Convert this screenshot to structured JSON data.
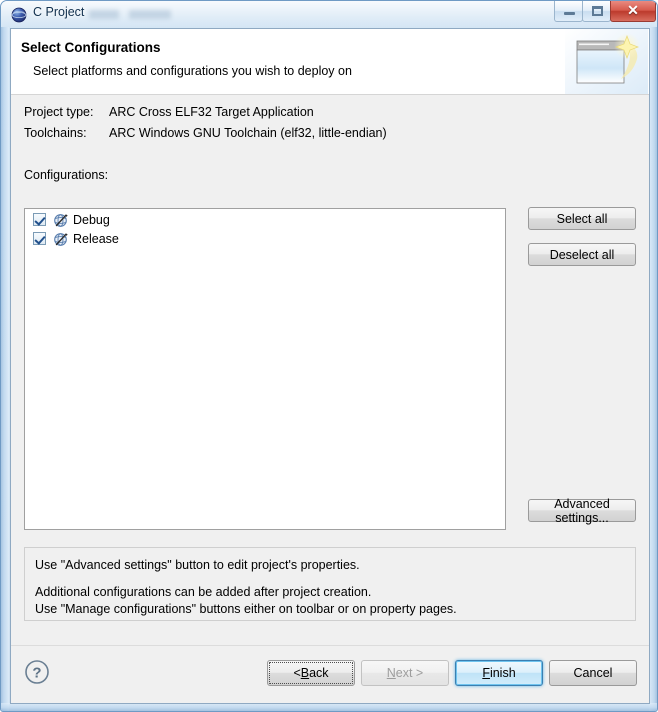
{
  "window": {
    "title": "C Project",
    "icon": "eclipse-globe-icon",
    "controls": {
      "minimize": "minimize-icon",
      "restore": "restore-icon",
      "close_glyph": "✕"
    }
  },
  "banner": {
    "title": "Select Configurations",
    "subtitle": "Select platforms and configurations you wish to deploy on",
    "image": "new-wizard-banner-icon"
  },
  "summary": [
    {
      "label": "Project type:",
      "value": "ARC Cross ELF32 Target Application"
    },
    {
      "label": "Toolchains:",
      "value": "ARC Windows GNU Toolchain (elf32, little-endian)"
    }
  ],
  "configurations_label": "Configurations:",
  "configurations": [
    {
      "name": "Debug",
      "checked": true,
      "icon": "configuration-icon"
    },
    {
      "name": "Release",
      "checked": true,
      "icon": "configuration-icon"
    }
  ],
  "side_buttons": {
    "select_all": "Select all",
    "deselect_all": "Deselect all",
    "advanced_settings": "Advanced settings..."
  },
  "notes": {
    "line1": "Use \"Advanced settings\" button to edit project's properties.",
    "line2": "Additional configurations can be added after project creation.",
    "line3": "Use \"Manage configurations\" buttons either on toolbar or on property pages."
  },
  "footer": {
    "help": "help-icon",
    "buttons": {
      "back_pre": "< ",
      "back_mnemonic": "B",
      "back_post": "ack",
      "next_mnemonic": "N",
      "next_post": "ext >",
      "finish_mnemonic": "F",
      "finish_post": "inish",
      "cancel": "Cancel"
    }
  },
  "colors": {
    "accent": "#3c7fb1",
    "close_button": "#bc3a2c",
    "dialog_bg": "#f0f0f0",
    "list_bg": "#ffffff"
  }
}
